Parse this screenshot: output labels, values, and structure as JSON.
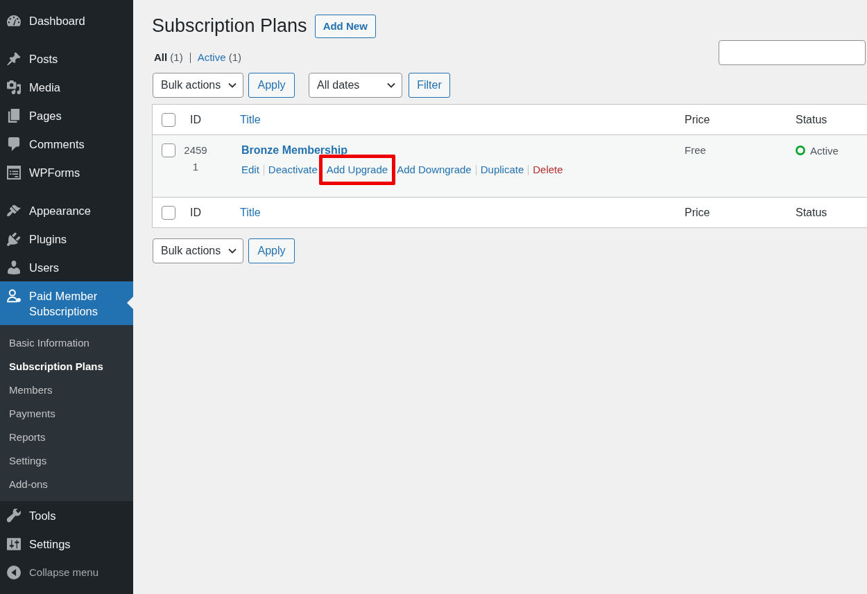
{
  "sidebar": {
    "groups": [
      {
        "items": [
          {
            "label": "Dashboard",
            "selected": false
          }
        ]
      },
      {
        "items": [
          {
            "label": "Posts",
            "selected": false
          },
          {
            "label": "Media",
            "selected": false
          },
          {
            "label": "Pages",
            "selected": false
          },
          {
            "label": "Comments",
            "selected": false
          },
          {
            "label": "WPForms",
            "selected": false
          }
        ]
      },
      {
        "items": [
          {
            "label": "Appearance",
            "selected": false
          },
          {
            "label": "Plugins",
            "selected": false
          },
          {
            "label": "Users",
            "selected": false
          },
          {
            "label": "Paid Member Subscriptions",
            "selected": true,
            "submenu": [
              {
                "label": "Basic Information",
                "selected": false
              },
              {
                "label": "Subscription Plans",
                "selected": true
              },
              {
                "label": "Members",
                "selected": false
              },
              {
                "label": "Payments",
                "selected": false
              },
              {
                "label": "Reports",
                "selected": false
              },
              {
                "label": "Settings",
                "selected": false
              },
              {
                "label": "Add-ons",
                "selected": false
              }
            ]
          },
          {
            "label": "Tools",
            "selected": false
          },
          {
            "label": "Settings",
            "selected": false
          }
        ]
      }
    ],
    "collapse": "Collapse menu"
  },
  "page": {
    "title": "Subscription Plans",
    "add_new": "Add New"
  },
  "views": [
    {
      "label": "All",
      "count": "(1)",
      "selected": true
    },
    {
      "label": "Active",
      "count": "(1)",
      "selected": false
    }
  ],
  "tablenav_top": {
    "bulk_actions": "Bulk actions",
    "apply": "Apply",
    "dates": "All dates",
    "filter": "Filter"
  },
  "table": {
    "header_checked": false,
    "columns": [
      {
        "label": "ID",
        "sortable": false
      },
      {
        "label": "Title",
        "sortable": true
      },
      {
        "label": "Price",
        "sortable": false
      },
      {
        "label": "Status",
        "sortable": false
      }
    ],
    "rows": [
      {
        "checked": false,
        "id": "24591",
        "title": "Bronze Membership",
        "actions": [
          {
            "label": "Edit",
            "kind": "link",
            "highlighted": false
          },
          {
            "label": "Deactivate",
            "kind": "link",
            "highlighted": false
          },
          {
            "label": "Add Upgrade",
            "kind": "link",
            "highlighted": true
          },
          {
            "label": "Add Downgrade",
            "kind": "link",
            "highlighted": false
          },
          {
            "label": "Duplicate",
            "kind": "link",
            "highlighted": false
          },
          {
            "label": "Delete",
            "kind": "delete",
            "highlighted": false
          }
        ],
        "price": "Free",
        "status": {
          "label": "Active",
          "color": "#00a32a"
        }
      }
    ],
    "footer_checked": false,
    "footer_columns": [
      {
        "label": "ID",
        "sortable": false
      },
      {
        "label": "Title",
        "sortable": true
      },
      {
        "label": "Price",
        "sortable": false
      },
      {
        "label": "Status",
        "sortable": false
      }
    ]
  },
  "tablenav_bottom": {
    "bulk_actions": "Bulk actions",
    "apply": "Apply"
  }
}
